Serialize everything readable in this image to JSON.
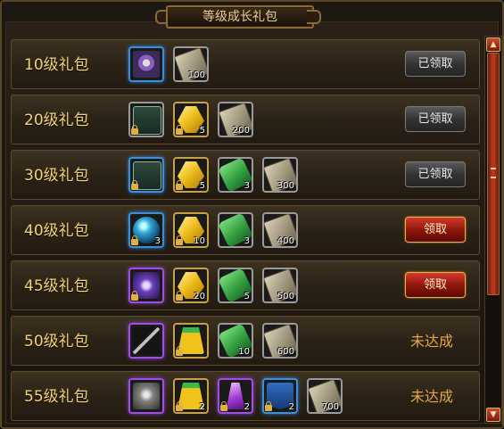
{
  "window": {
    "title": "等级成长礼包"
  },
  "rows": [
    {
      "level": "10级礼包",
      "items": [
        {
          "icon": "helmet",
          "quality": "blue",
          "count": "",
          "locked": false
        },
        {
          "icon": "scroll",
          "quality": "gray",
          "count": "100",
          "locked": false
        }
      ],
      "action": {
        "type": "button",
        "label": "已领取",
        "style": "gray"
      }
    },
    {
      "level": "20级礼包",
      "items": [
        {
          "icon": "chest-lock",
          "quality": "gray",
          "count": "",
          "locked": true
        },
        {
          "icon": "gold-ingot",
          "quality": "gold",
          "count": "5",
          "locked": true
        },
        {
          "icon": "scroll",
          "quality": "gray",
          "count": "200",
          "locked": false
        }
      ],
      "action": {
        "type": "button",
        "label": "已领取",
        "style": "gray"
      }
    },
    {
      "level": "30级礼包",
      "items": [
        {
          "icon": "chest-lock",
          "quality": "blue",
          "count": "",
          "locked": true
        },
        {
          "icon": "gold-ingot",
          "quality": "gold",
          "count": "5",
          "locked": true
        },
        {
          "icon": "green-ticket",
          "quality": "gray",
          "count": "3",
          "locked": false
        },
        {
          "icon": "scroll",
          "quality": "gray",
          "count": "300",
          "locked": false
        }
      ],
      "action": {
        "type": "button",
        "label": "已领取",
        "style": "gray"
      }
    },
    {
      "level": "40级礼包",
      "items": [
        {
          "icon": "blue-orb",
          "quality": "blue",
          "count": "3",
          "locked": true
        },
        {
          "icon": "gold-ingot",
          "quality": "gold",
          "count": "10",
          "locked": true
        },
        {
          "icon": "green-ticket",
          "quality": "gray",
          "count": "3",
          "locked": false
        },
        {
          "icon": "scroll",
          "quality": "gray",
          "count": "400",
          "locked": false
        }
      ],
      "action": {
        "type": "button",
        "label": "领取",
        "style": "red"
      }
    },
    {
      "level": "45级礼包",
      "items": [
        {
          "icon": "purple-armor",
          "quality": "purple",
          "count": "",
          "locked": true
        },
        {
          "icon": "gold-ingot",
          "quality": "gold",
          "count": "20",
          "locked": true
        },
        {
          "icon": "green-ticket",
          "quality": "gray",
          "count": "5",
          "locked": false
        },
        {
          "icon": "scroll",
          "quality": "gray",
          "count": "500",
          "locked": false
        }
      ],
      "action": {
        "type": "button",
        "label": "领取",
        "style": "red"
      }
    },
    {
      "level": "50级礼包",
      "items": [
        {
          "icon": "spear",
          "quality": "purple",
          "count": "",
          "locked": false
        },
        {
          "icon": "yellow-robe",
          "quality": "gold",
          "count": "",
          "locked": true
        },
        {
          "icon": "green-ticket",
          "quality": "gray",
          "count": "10",
          "locked": false
        },
        {
          "icon": "scroll",
          "quality": "gray",
          "count": "600",
          "locked": false
        }
      ],
      "action": {
        "type": "status",
        "label": "未达成"
      }
    },
    {
      "level": "55级礼包",
      "items": [
        {
          "icon": "gray-armor",
          "quality": "purple",
          "count": "",
          "locked": false
        },
        {
          "icon": "yellow-robe",
          "quality": "gold",
          "count": "2",
          "locked": true
        },
        {
          "icon": "purple-crystal",
          "quality": "purple",
          "count": "2",
          "locked": true
        },
        {
          "icon": "blue-banner",
          "quality": "blue",
          "count": "2",
          "locked": true
        },
        {
          "icon": "scroll",
          "quality": "gray",
          "count": "700",
          "locked": false
        }
      ],
      "action": {
        "type": "status",
        "label": "未达成"
      }
    }
  ],
  "scrollbar": {
    "up_icon": "arrow-up-icon",
    "down_icon": "arrow-down-icon"
  }
}
